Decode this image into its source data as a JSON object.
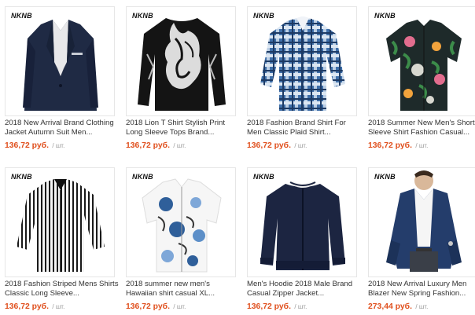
{
  "brand_label": "NKNB",
  "unit_label": "/ шт.",
  "colors": {
    "price": "#e0501e",
    "title": "#333333",
    "unit": "#999999",
    "border": "#e6e6e6"
  },
  "products": [
    {
      "line1": "2018 New Arrival Brand Clothing",
      "line2": "Jacket Autumn Suit Men...",
      "price": "136,72 руб.",
      "image": "navy-suit-blazer"
    },
    {
      "line1": "2018 Lion T Shirt Stylish Print",
      "line2": "Long Sleeve Tops Brand...",
      "price": "136,72 руб.",
      "image": "black-lion-print-tshirt"
    },
    {
      "line1": "2018 Fashion Brand Shirt For",
      "line2": "Men Classic Plaid Shirt...",
      "price": "136,72 руб.",
      "image": "blue-plaid-shirt"
    },
    {
      "line1": "2018 Summer New Men's Short",
      "line2": "Sleeve Shirt Fashion Casual...",
      "price": "136,72 руб.",
      "image": "floral-short-sleeve-shirt"
    },
    {
      "line1": "2018 Fashion Striped Mens Shirts",
      "line2": "Classic Long Sleeve...",
      "price": "136,72 руб.",
      "image": "striped-shirt"
    },
    {
      "line1": "2018 summer new men's",
      "line2": "Hawaiian shirt casual XL...",
      "price": "136,72 руб.",
      "image": "blue-floral-hawaiian-shirt"
    },
    {
      "line1": "Men's Hoodie 2018 Male Brand",
      "line2": "Casual Zipper Jacket...",
      "price": "136,72 руб.",
      "image": "navy-zipper-jacket"
    },
    {
      "line1": "2018 New Arrival Luxury Men",
      "line2": "Blazer New Spring Fashion...",
      "price": "273,44 руб.",
      "image": "navy-blazer-model"
    }
  ]
}
